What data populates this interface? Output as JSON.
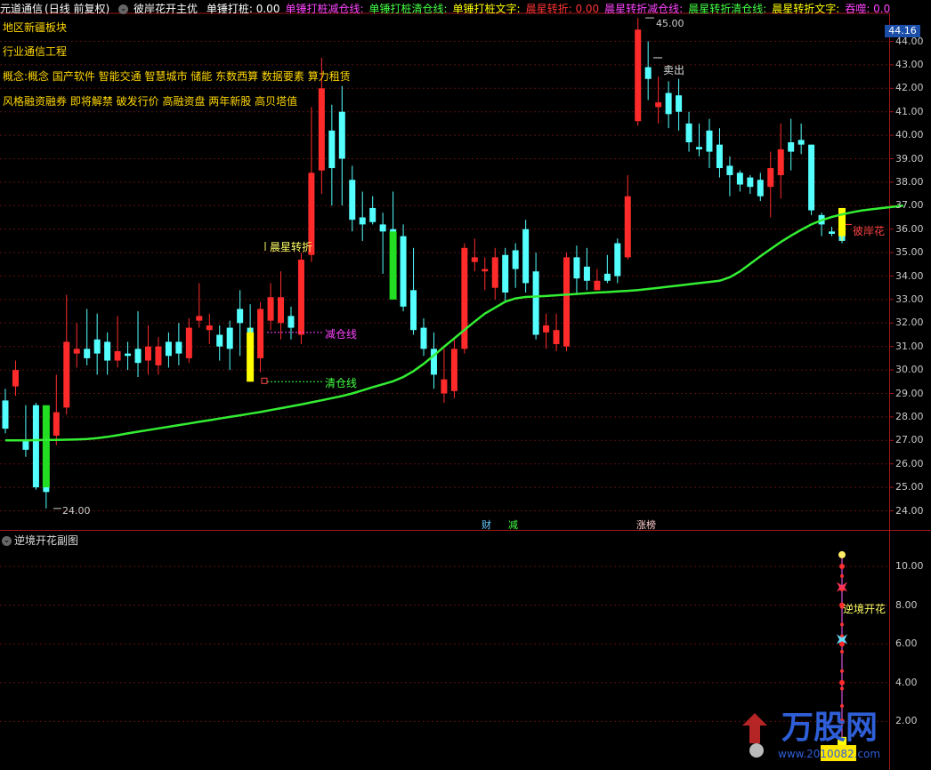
{
  "header": {
    "app": "元道通信",
    "period": "(日线 前复权)",
    "indicator": "彼岸花开主优",
    "items": [
      {
        "text": "单锤打桩: 0.00",
        "color": "#ffffff"
      },
      {
        "text": "单锤打桩减仓线:",
        "color": "#ff44ff"
      },
      {
        "text": "单锤打桩清仓线:",
        "color": "#44ff44"
      },
      {
        "text": "单锤打桩文字:",
        "color": "#ffff00"
      },
      {
        "text": "晨星转折: 0.00",
        "color": "#ff3333"
      },
      {
        "text": "晨星转折减仓线:",
        "color": "#ff44ff"
      },
      {
        "text": "晨星转折清仓线:",
        "color": "#44ff44"
      },
      {
        "text": "晨星转折文字:",
        "color": "#ffff00"
      },
      {
        "text": "吞噬: 0.0",
        "color": "#ff44ff"
      }
    ]
  },
  "info_lines": [
    "地区新疆板块",
    "行业通信工程",
    "概念:概念 国产软件 智能交通 智慧城市 储能 东数西算 数据要素 算力租赁",
    "风格融资融券 即将解禁 破发行价 高融资盘 两年新股 高贝塔值"
  ],
  "current_price": "44.16",
  "price_axis": [
    "44.00",
    "43.00",
    "42.00",
    "41.00",
    "40.00",
    "39.00",
    "38.00",
    "37.00",
    "36.00",
    "35.00",
    "34.00",
    "33.00",
    "32.00",
    "31.00",
    "30.00",
    "29.00",
    "28.00",
    "27.00",
    "26.00",
    "25.00",
    "24.00"
  ],
  "sub_axis": [
    "10.00",
    "8.00",
    "6.00",
    "4.00",
    "2.00"
  ],
  "annotations": {
    "high": "45.00",
    "low": "24.00",
    "sell": "卖出",
    "morning_star": "晨星转折",
    "reduce_line": "减仓线",
    "clear_line": "清仓线",
    "bianhua": "彼岸花",
    "cai": "财",
    "jian": "减",
    "zhangbang": "涨榜"
  },
  "sub_chart": {
    "title": "逆境开花副图",
    "label": "逆境开花"
  },
  "watermark": {
    "text": "万股网",
    "url": "www.2010082.com"
  },
  "chart_data": {
    "type": "candlestick",
    "ylim": [
      23.5,
      45.3
    ],
    "candles": [
      [
        28.7,
        27.5,
        29.2,
        27.3
      ],
      [
        29.3,
        30.0,
        30.4,
        28.9
      ],
      [
        27.0,
        26.6,
        28.5,
        26.3
      ],
      [
        28.5,
        25.0,
        28.6,
        24.9
      ],
      [
        27.0,
        24.8,
        27.2,
        24.1
      ],
      [
        27.2,
        28.2,
        29.8,
        26.8
      ],
      [
        28.4,
        31.2,
        33.2,
        28.1
      ],
      [
        30.7,
        30.9,
        32.0,
        30.1
      ],
      [
        30.9,
        30.5,
        32.6,
        30.2
      ],
      [
        31.3,
        30.7,
        32.4,
        29.8
      ],
      [
        31.2,
        30.4,
        31.6,
        29.8
      ],
      [
        30.4,
        30.8,
        32.3,
        30.1
      ],
      [
        30.7,
        30.6,
        31.2,
        30.0
      ],
      [
        30.9,
        30.3,
        32.5,
        29.7
      ],
      [
        30.4,
        31.0,
        31.9,
        29.8
      ],
      [
        30.2,
        31.0,
        31.4,
        29.8
      ],
      [
        31.2,
        30.6,
        31.6,
        30.1
      ],
      [
        31.2,
        30.7,
        32.0,
        30.2
      ],
      [
        30.5,
        31.8,
        32.2,
        30.3
      ],
      [
        32.1,
        32.3,
        33.7,
        31.8
      ],
      [
        31.7,
        31.9,
        32.4,
        31.1
      ],
      [
        31.5,
        31.0,
        31.9,
        30.4
      ],
      [
        31.8,
        30.9,
        32.1,
        30.0
      ],
      [
        32.6,
        32.0,
        33.4,
        30.6
      ],
      [
        31.8,
        31.1,
        32.8,
        29.6
      ],
      [
        30.5,
        32.6,
        32.9,
        29.9
      ],
      [
        32.1,
        33.1,
        33.7,
        31.7
      ],
      [
        32.0,
        33.1,
        34.2,
        31.3
      ],
      [
        32.3,
        31.8,
        32.7,
        31.3
      ],
      [
        31.5,
        34.7,
        35.0,
        31.1
      ],
      [
        34.9,
        38.4,
        41.2,
        34.6
      ],
      [
        38.5,
        42.0,
        43.3,
        37.5
      ],
      [
        40.2,
        38.6,
        41.3,
        37.0
      ],
      [
        41.0,
        39.0,
        42.1,
        37.0
      ],
      [
        38.1,
        36.4,
        38.7,
        35.9
      ],
      [
        36.5,
        36.2,
        37.6,
        35.5
      ],
      [
        36.9,
        36.3,
        37.4,
        36.2
      ],
      [
        36.2,
        35.9,
        36.7,
        34.1
      ],
      [
        36.0,
        35.3,
        37.6,
        35.0
      ],
      [
        35.7,
        32.7,
        36.2,
        32.5
      ],
      [
        33.4,
        31.7,
        35.2,
        31.5
      ],
      [
        31.8,
        30.9,
        32.2,
        30.6
      ],
      [
        30.9,
        29.8,
        31.6,
        29.2
      ],
      [
        29.0,
        29.6,
        30.9,
        28.6
      ],
      [
        29.1,
        30.9,
        31.3,
        28.8
      ],
      [
        30.9,
        35.2,
        35.4,
        30.7
      ],
      [
        34.6,
        34.8,
        35.6,
        34.2
      ],
      [
        34.2,
        34.3,
        34.8,
        33.4
      ],
      [
        33.5,
        34.8,
        35.2,
        33.0
      ],
      [
        34.9,
        33.3,
        35.2,
        32.9
      ],
      [
        35.1,
        34.3,
        35.4,
        33.5
      ],
      [
        36.0,
        33.7,
        36.4,
        33.3
      ],
      [
        34.2,
        31.5,
        35.0,
        31.3
      ],
      [
        31.6,
        31.9,
        32.4,
        30.9
      ],
      [
        31.1,
        31.7,
        32.4,
        30.8
      ],
      [
        31.0,
        34.8,
        35.0,
        30.8
      ],
      [
        34.8,
        33.9,
        35.3,
        33.2
      ],
      [
        34.4,
        33.8,
        35.2,
        33.4
      ],
      [
        33.4,
        33.8,
        34.3,
        33.4
      ],
      [
        34.1,
        33.8,
        34.9,
        33.7
      ],
      [
        35.4,
        34.0,
        35.6,
        33.7
      ],
      [
        34.8,
        37.4,
        38.3,
        34.7
      ],
      [
        40.6,
        44.5,
        45.0,
        40.4
      ],
      [
        42.9,
        42.4,
        44.0,
        41.5
      ],
      [
        41.2,
        41.4,
        42.5,
        40.5
      ],
      [
        41.8,
        40.9,
        42.3,
        40.3
      ],
      [
        41.7,
        41.0,
        42.4,
        40.2
      ],
      [
        40.5,
        39.7,
        41.0,
        39.3
      ],
      [
        39.5,
        39.4,
        40.5,
        39.1
      ],
      [
        40.2,
        39.3,
        40.7,
        38.6
      ],
      [
        39.6,
        38.6,
        40.3,
        38.2
      ],
      [
        38.7,
        38.3,
        39.1,
        37.4
      ],
      [
        38.4,
        37.9,
        38.5,
        37.6
      ],
      [
        38.2,
        37.8,
        38.3,
        37.5
      ],
      [
        38.1,
        37.4,
        38.4,
        37.2
      ],
      [
        37.8,
        38.6,
        39.3,
        36.5
      ],
      [
        38.3,
        39.4,
        40.5,
        37.3
      ],
      [
        39.7,
        39.3,
        40.7,
        38.5
      ],
      [
        39.8,
        39.6,
        40.5,
        39.2
      ],
      [
        39.6,
        36.8,
        39.6,
        36.6
      ],
      [
        36.6,
        36.2,
        36.7,
        35.7
      ],
      [
        35.9,
        35.8,
        36.1,
        35.7
      ],
      [
        36.7,
        35.5,
        36.8,
        35.4
      ]
    ],
    "ma": [
      27.0,
      27.0,
      27.0,
      27.01,
      27.02,
      27.02,
      27.03,
      27.04,
      27.06,
      27.1,
      27.15,
      27.22,
      27.3,
      27.37,
      27.44,
      27.51,
      27.58,
      27.65,
      27.72,
      27.79,
      27.86,
      27.93,
      28.0,
      28.07,
      28.14,
      28.21,
      28.29,
      28.37,
      28.45,
      28.53,
      28.62,
      28.71,
      28.8,
      28.89,
      29.0,
      29.13,
      29.27,
      29.39,
      29.52,
      29.7,
      29.95,
      30.26,
      30.62,
      30.99,
      31.35,
      31.71,
      32.06,
      32.4,
      32.65,
      32.91,
      33.05,
      33.11,
      33.13,
      33.15,
      33.18,
      33.21,
      33.24,
      33.27,
      33.3,
      33.32,
      33.35,
      33.37,
      33.4,
      33.45,
      33.5,
      33.55,
      33.6,
      33.65,
      33.7,
      33.75,
      33.8,
      33.95,
      34.2,
      34.52,
      34.84,
      35.15,
      35.45,
      35.72,
      35.97,
      36.2,
      36.38,
      36.52,
      36.63,
      36.72,
      36.8,
      36.85,
      36.9,
      36.95,
      37.0
    ],
    "yellow_candles": [
      [
        29.5,
        31.6,
        31.8,
        29.5
      ],
      [
        36.9,
        35.7,
        36.9,
        35.5
      ]
    ],
    "sub_values": [
      10.0,
      8.0,
      6.0,
      4.0,
      2.0
    ]
  }
}
